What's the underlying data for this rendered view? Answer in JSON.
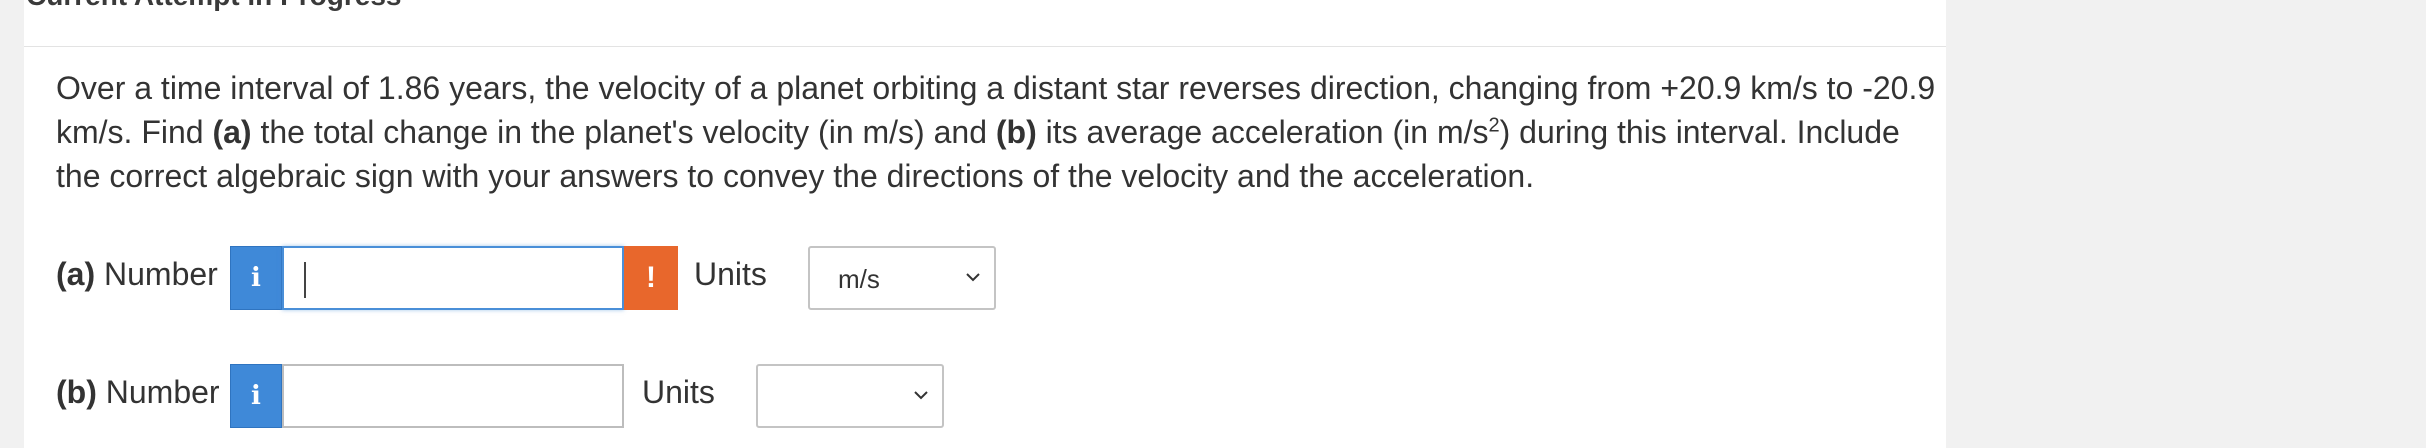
{
  "header": {
    "title": "Current Attempt in Progress"
  },
  "question": {
    "text_1": "Over a time interval of 1.86 years, the velocity of a planet orbiting a distant star reverses direction, changing from +20.9 km/s to -20.9 km/s. Find ",
    "part_a_marker": "(a)",
    "text_2": " the total change in the planet's velocity (in m/s) and ",
    "part_b_marker": "(b)",
    "text_3": " its average acceleration (in m/s",
    "superscript": "2",
    "text_4": ") during this interval. Include the correct algebraic sign with your answers to convey the directions of the velocity and the acceleration."
  },
  "part_a": {
    "marker": "(a)",
    "label": " Number",
    "info_icon_glyph": "i",
    "input_value": "",
    "warning_icon_glyph": "!",
    "units_label": "Units",
    "units_selected": "m/s"
  },
  "part_b": {
    "marker": "(b)",
    "label": " Number",
    "info_icon_glyph": "i",
    "input_value": "",
    "units_label": "Units",
    "units_selected": ""
  },
  "icons": {
    "info": "info-icon",
    "warning": "exclamation-icon",
    "dropdown": "chevron-down-icon"
  },
  "colors": {
    "info_button": "#3f89d8",
    "warning_button": "#e8672c",
    "focus_border": "#4a8fd8"
  }
}
